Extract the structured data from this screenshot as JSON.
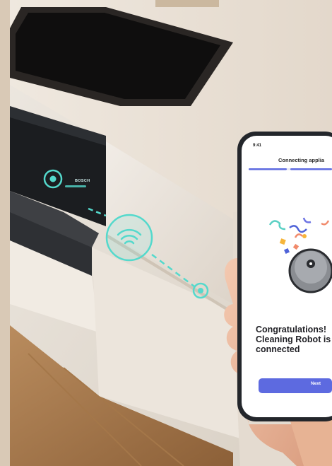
{
  "appliance": {
    "brand": "BOSCH"
  },
  "phone": {
    "status_time": "9:41",
    "screen_title": "Connecting applia",
    "message_line1": "Congratulations!",
    "message_line2": "Cleaning Robot is",
    "message_line3": "connected",
    "next_label": "Next"
  },
  "colors": {
    "accent": "#5d6ae0",
    "connection": "#54d9cc"
  }
}
